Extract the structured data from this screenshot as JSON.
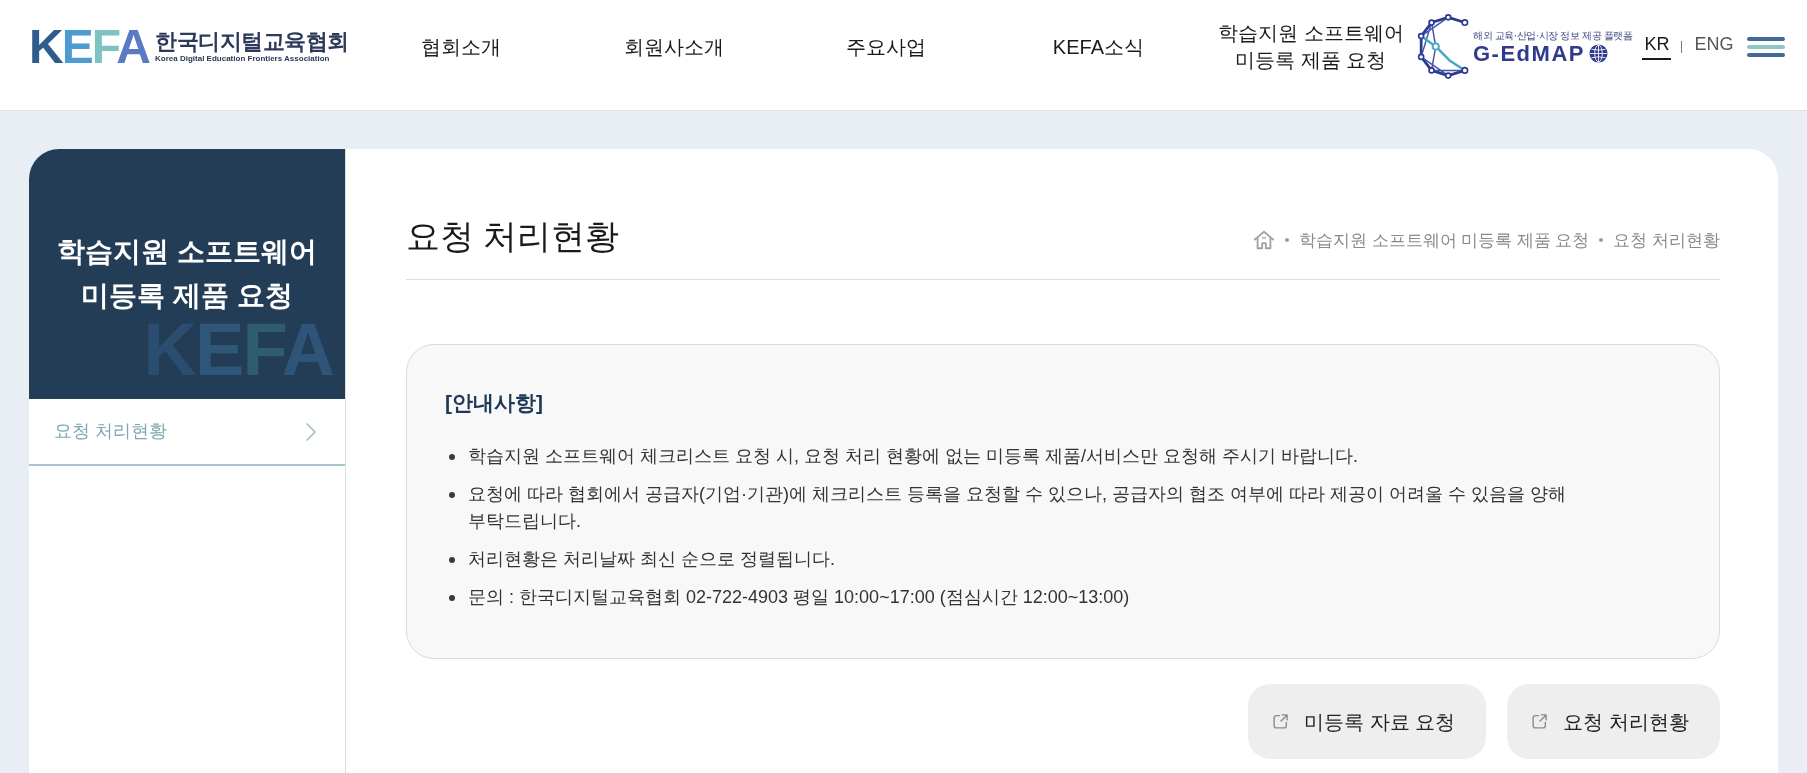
{
  "header": {
    "logo": {
      "mark": "KEFA",
      "name": "한국디지털교육협회",
      "subtitle": "Korea Digital Education Frontiers Association"
    },
    "nav": [
      {
        "label": "협회소개"
      },
      {
        "label": "회원사소개"
      },
      {
        "label": "주요사업"
      },
      {
        "label": "KEFA소식"
      },
      {
        "label": "학습지원 소프트웨어 미등록 제품 요청"
      }
    ],
    "partner_logo": {
      "tagline": "해외 교육·산업·시장 정보 제공 플랫폼",
      "name": "G-EdMAP"
    },
    "languages": [
      {
        "label": "KR",
        "selected": true
      },
      {
        "label": "ENG",
        "selected": false
      }
    ]
  },
  "sidebar": {
    "title": "학습지원 소프트웨어 미등록 제품 요청",
    "watermark": "KEFA",
    "items": [
      {
        "label": "요청 처리현황",
        "selected": true
      }
    ]
  },
  "page": {
    "title": "요청 처리현황",
    "breadcrumb": [
      "학습지원 소프트웨어 미등록 제품 요청",
      "요청 처리현황"
    ]
  },
  "notice": {
    "title": "[안내사항]",
    "items": [
      "학습지원 소프트웨어 체크리스트 요청 시, 요청 처리 현황에 없는 미등록 제품/서비스만 요청해 주시기 바랍니다.",
      "요청에 따라 협회에서 공급자(기업·기관)에 체크리스트 등록을 요청할 수 있으나, 공급자의 협조 여부에 따라 제공이 어려울 수 있음을 양해 부탁드립니다.",
      "처리현황은 처리날짜 최신 순으로 정렬됩니다.",
      "문의 : 한국디지털교육협회 02-722-4903 평일 10:00~17:00 (점심시간 12:00~13:00)"
    ]
  },
  "buttons": [
    "미등록 자료 요청",
    "요청 처리현황"
  ]
}
